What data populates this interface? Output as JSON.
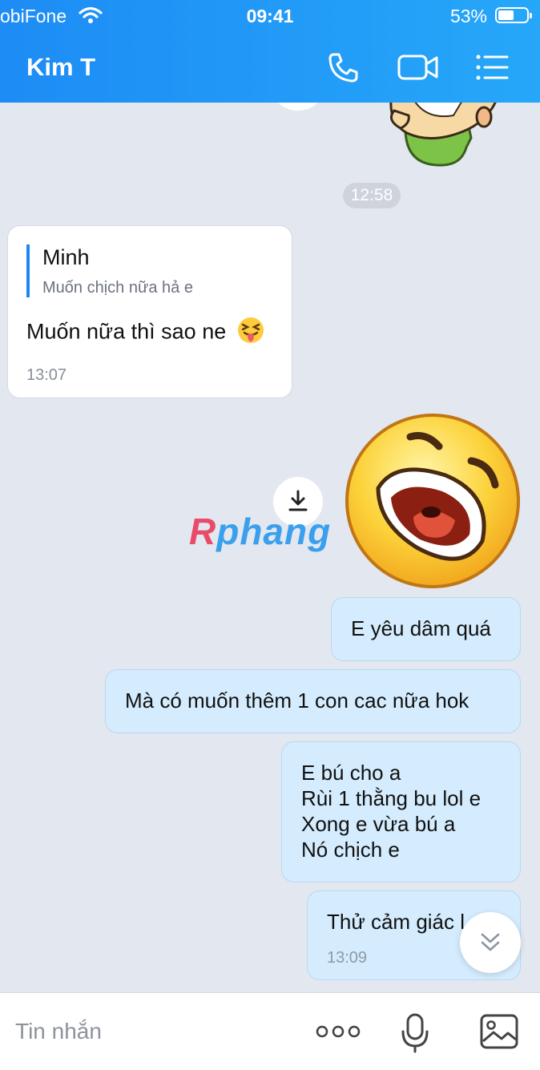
{
  "status_bar": {
    "carrier": "obiFone",
    "time": "09:41",
    "battery": "53%"
  },
  "header": {
    "title": "Kim T"
  },
  "chat": {
    "time_separator": "12:58",
    "received": {
      "quote_name": "Minh",
      "quote_text": "Muốn chịch nữa hả e",
      "text": "Muốn nữa thì sao ne",
      "time": "13:07"
    },
    "watermark": "Rphang",
    "sent": [
      {
        "text": "E yêu dâm quá"
      },
      {
        "text": "Mà có muốn thêm 1 con cac nữa hok"
      },
      {
        "text": "E bú cho a\nRùi 1 thằng bu lol e\nXong e vừa bú a\nNó chịch e"
      },
      {
        "text": "Thử cảm giác l",
        "time": "13:09"
      }
    ]
  },
  "input": {
    "placeholder": "Tin nhắn"
  }
}
